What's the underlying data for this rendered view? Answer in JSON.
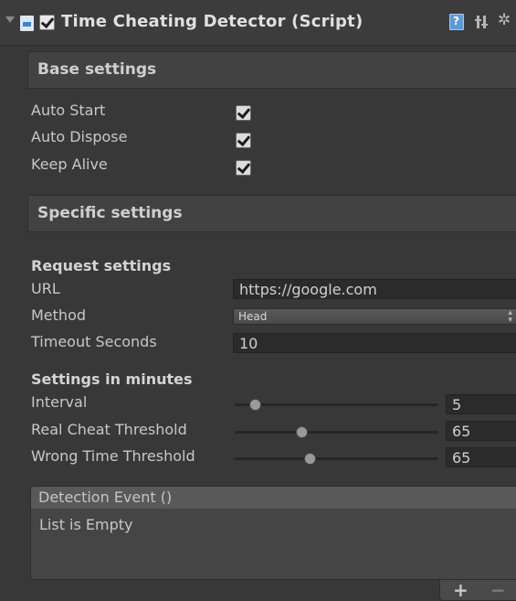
{
  "component": {
    "title": "Time Cheating Detector (Script)",
    "enabled": true,
    "icons": [
      "foldout-arrow-icon",
      "script-icon",
      "help-icon",
      "preset-icon",
      "gear-icon"
    ]
  },
  "base_settings": {
    "header": "Base settings",
    "fields": [
      {
        "label": "Auto Start",
        "checked": true
      },
      {
        "label": "Auto Dispose",
        "checked": true
      },
      {
        "label": "Keep Alive",
        "checked": true
      }
    ]
  },
  "specific_settings": {
    "header": "Specific settings",
    "request": {
      "title": "Request settings",
      "url_label": "URL",
      "url_value": "https://google.com",
      "method_label": "Method",
      "method_value": "Head",
      "timeout_label": "Timeout Seconds",
      "timeout_value": "10"
    },
    "minutes": {
      "title": "Settings in minutes",
      "sliders": [
        {
          "label": "Interval",
          "value": "5",
          "fraction": 0.1
        },
        {
          "label": "Real Cheat Threshold",
          "value": "65",
          "fraction": 0.33
        },
        {
          "label": "Wrong Time Threshold",
          "value": "65",
          "fraction": 0.37
        }
      ]
    }
  },
  "event": {
    "header": "Detection Event ()",
    "empty_text": "List is Empty",
    "add_label": "+",
    "remove_label": "−"
  },
  "colors": {
    "background": "#383838",
    "accent": "#5a9bd8"
  }
}
